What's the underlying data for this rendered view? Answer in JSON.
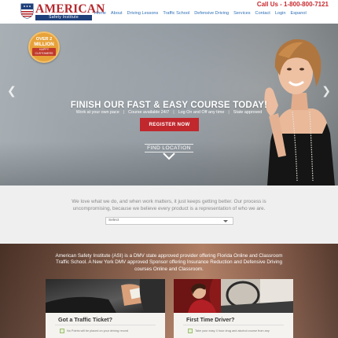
{
  "header": {
    "logo_main": "AMERICAN",
    "logo_sub": "Safety Institute",
    "phone": "Call Us - 1-800-800-7121",
    "nav": [
      "Home",
      "About",
      "Driving Lessons",
      "Traffic School",
      "Defensive Driving",
      "Services",
      "Contact",
      "Login",
      "Espanol"
    ]
  },
  "hero": {
    "badge": {
      "line1": "OVER 2",
      "line2": "MILLION",
      "line3": "HAPPY CUSTOMERS"
    },
    "title": "FINISH OUR FAST & EASY COURSE TODAY!",
    "features": [
      "Work at your own pace",
      "Course available 24/7",
      "Log On and Off any time",
      "State approved"
    ],
    "register_label": "REGISTER NOW",
    "find_location_label": "FIND LOCATION",
    "prev_icon": "chevron-left-icon",
    "next_icon": "chevron-right-icon"
  },
  "intro": {
    "text": "We love what we do, and when work matters, it just keeps getting better. Our process is uncompromising, because we believe every product is a representation of who we are.",
    "select_value": "Select"
  },
  "lower": {
    "text": "American Safety Institute (ASI) is a DMV state approved provider offering Florida Online and Classroom Traffic School. A New York DMV approved Sponsor offering Insurance Reduction and Defensive Driving courses Online and Classroom.",
    "cards": [
      {
        "title": "Got a Traffic Ticket?",
        "item": "No Points will be placed on your driving record"
      },
      {
        "title": "First Time Driver?",
        "item": "Take your easy 4 hour drug and alcohol course from any"
      }
    ]
  },
  "colors": {
    "brand_red": "#c0282d",
    "brand_blue": "#1e3f7a",
    "nav_blue": "#2e6fb5",
    "badge_gold": "#e7a23a"
  }
}
